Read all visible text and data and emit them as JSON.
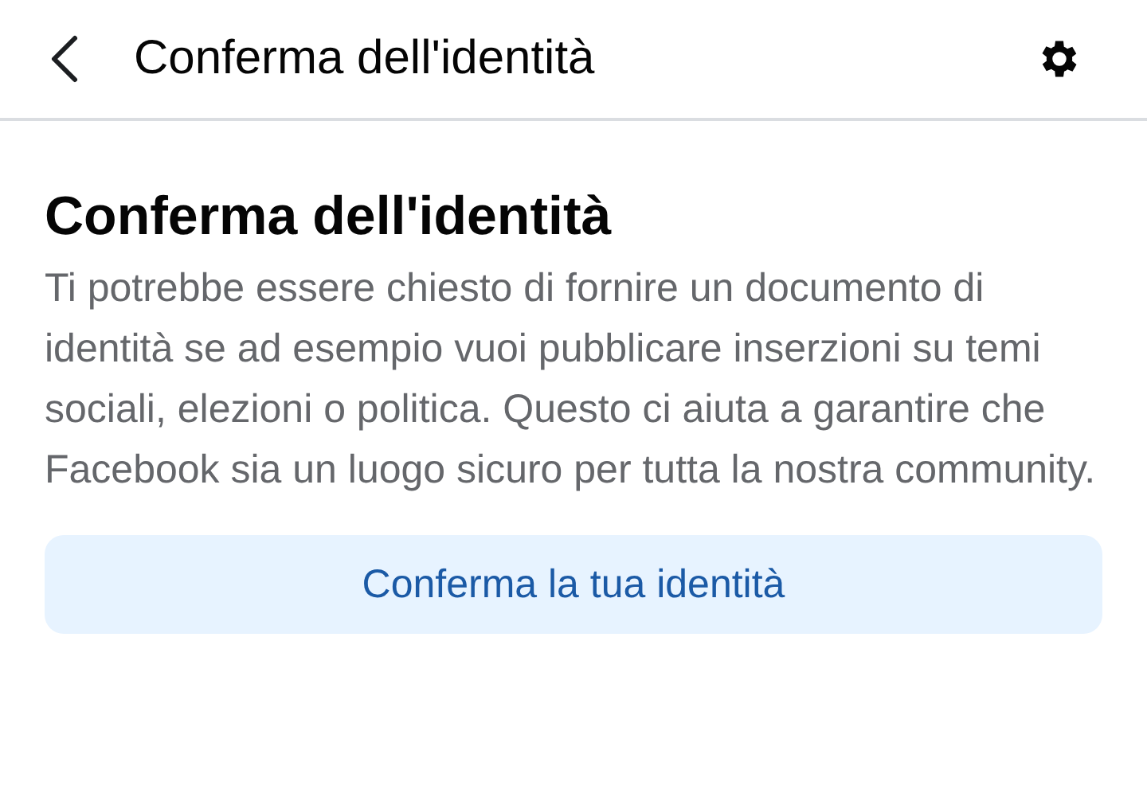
{
  "header": {
    "title": "Conferma dell'identità"
  },
  "content": {
    "heading": "Conferma dell'identità",
    "description": "Ti potrebbe essere chiesto di fornire un documento di identità se ad esempio vuoi pubblicare inserzioni su temi sociali, elezioni o politica. Questo ci aiuta a garantire che Facebook sia un luogo sicuro per tutta la nostra community.",
    "button": "Conferma la tua identità"
  }
}
